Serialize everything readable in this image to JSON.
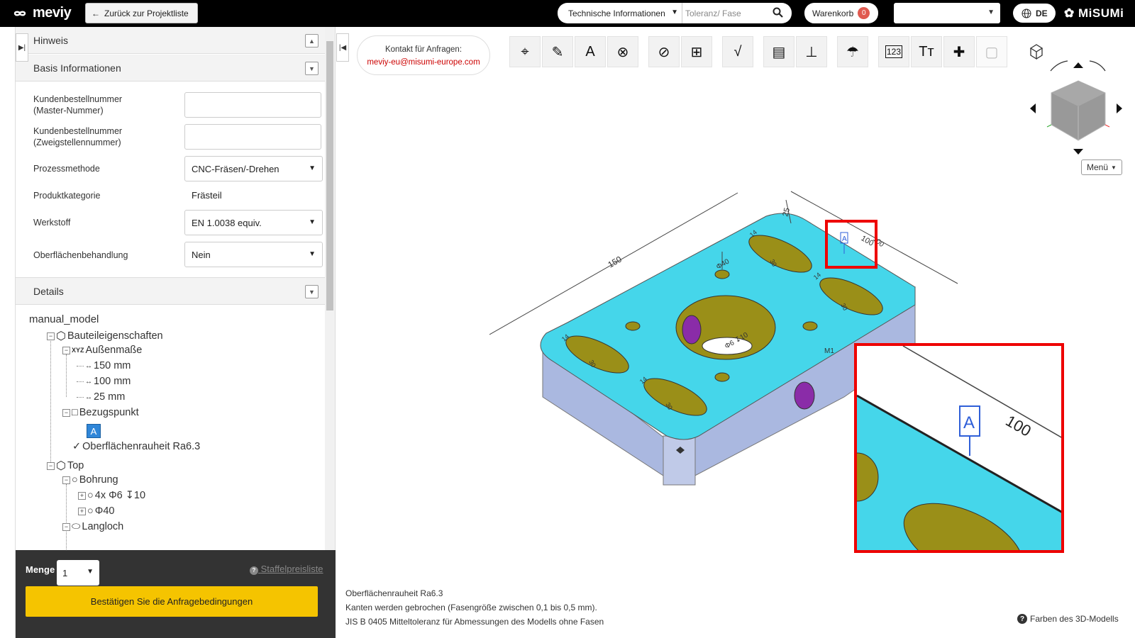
{
  "header": {
    "logo": "meviy",
    "back_label": "Zurück zur Projektliste",
    "tech_select": "Technische Informationen",
    "search_placeholder": "Toleranz/ Fase",
    "cart_label": "Warenkorb",
    "cart_count": "0",
    "lang": "DE",
    "brand": "MiSUMi"
  },
  "sidebar": {
    "hinweis": "Hinweis",
    "basis": "Basis Informationen",
    "fields": {
      "kunden_master_l1": "Kundenbestellnummer",
      "kunden_master_l2": "(Master-Nummer)",
      "kunden_zweig_l1": "Kundenbestellnummer",
      "kunden_zweig_l2": "(Zweigstellennummer)",
      "prozess_label": "Prozessmethode",
      "prozess_value": "CNC-Fräsen/-Drehen",
      "kategorie_label": "Produktkategorie",
      "kategorie_value": "Frästeil",
      "werkstoff_label": "Werkstoff",
      "werkstoff_value": "EN 1.0038 equiv.",
      "oberflaeche_label": "Oberflächenbehandlung",
      "oberflaeche_value": "Nein"
    },
    "details": "Details",
    "tree": {
      "root": "manual_model",
      "bauteil": "Bauteileigenschaften",
      "aussen": "Außenmaße",
      "x": "150 mm",
      "y": "100 mm",
      "z": "25 mm",
      "bezug": "Bezugspunkt",
      "bezug_a": "A",
      "rauheit": "Oberflächenrauheit Ra6.3",
      "top": "Top",
      "bohrung": "Bohrung",
      "b1": "4x Φ6 ↧10",
      "b2": "Φ40",
      "langloch": "Langloch"
    }
  },
  "footer": {
    "menge": "Menge",
    "menge_value": "1",
    "staffel": "Staffelpreisliste",
    "confirm": "Bestätigen Sie die Anfragebedingungen"
  },
  "viewer": {
    "contact_l1": "Kontakt für Anfragen:",
    "contact_l2": "meviy-eu@misumi-europe.com",
    "menu": "Menü",
    "notes": [
      "Oberflächenrauheit Ra6.3",
      "Kanten werden gebrochen (Fasengröße zwischen 0,1 bis 0,5 mm).",
      "JIS B 0405 Mitteltoleranz für Abmessungen des Modells ohne Fasen"
    ],
    "farben": "Farben des 3D-Modells",
    "dims": {
      "len": "150",
      "height": "25",
      "width": "100",
      "dia40": "Φ40",
      "bore": "Φ6 ↧10",
      "zoom_w": "100",
      "m": "M1",
      "slot_w": "14",
      "slot_l": "30"
    }
  },
  "colors": {
    "part_top": "#45d6ea",
    "part_side": "#aab8e0",
    "hole": "#9a8f18",
    "purple": "#8a2ca8",
    "highlight": "#ee0000",
    "confirm": "#f5c400"
  }
}
